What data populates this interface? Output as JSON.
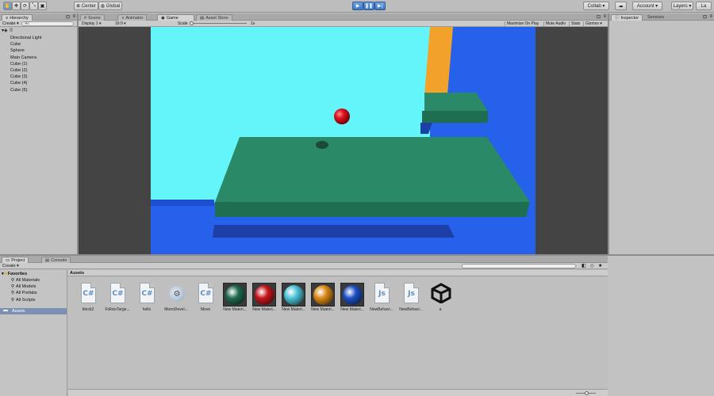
{
  "toolbar": {
    "pivot": "Center",
    "space": "Global",
    "collab": "Collab",
    "account": "Account",
    "layers": "Layers",
    "layout": "La"
  },
  "hierarchy": {
    "tab": "Hierarchy",
    "create": "Create",
    "search_placeholder": "All",
    "scene_icon": "unity-scene-icon",
    "items": [
      "Directional Light",
      "Cube",
      "Sphere",
      "Main Camera",
      "Cube (1)",
      "Cube (2)",
      "Cube (3)",
      "Cube (4)",
      "Cube (5)"
    ]
  },
  "center_tabs": [
    "Scene",
    "Animator",
    "Game",
    "Asset Store"
  ],
  "game_toolbar": {
    "display": "Display 1",
    "aspect": "16:9",
    "scale_label": "Scale",
    "scale_value": "1x",
    "maximize": "Maximize On Play",
    "mute": "Mute Audio",
    "stats": "Stats",
    "gizmos": "Gizmos"
  },
  "right_tabs": [
    "Inspector",
    "Services"
  ],
  "project": {
    "tabs": [
      "Project",
      "Console"
    ],
    "create": "Create",
    "favorites_label": "Favorites",
    "favorites": [
      "All Materials",
      "All Models",
      "All Prefabs",
      "All Scripts"
    ],
    "assets_folder": "Assets",
    "assets_header": "Assets",
    "assets": [
      {
        "name": "block2",
        "kind": "cs"
      },
      {
        "name": "FollowTarge...",
        "kind": "cs"
      },
      {
        "name": "hello",
        "kind": "cs"
      },
      {
        "name": "MonoDevel...",
        "kind": "mono"
      },
      {
        "name": "Move",
        "kind": "cs"
      },
      {
        "name": "New Materi...",
        "kind": "mat",
        "color": "#1f6b4f"
      },
      {
        "name": "New Materi...",
        "kind": "mat",
        "color": "#c4151c"
      },
      {
        "name": "New Materi...",
        "kind": "mat",
        "color": "#4cc3d6"
      },
      {
        "name": "New Materi...",
        "kind": "mat",
        "color": "#d98916"
      },
      {
        "name": "New Materi...",
        "kind": "mat",
        "color": "#1c4fc2"
      },
      {
        "name": "NewBehavi...",
        "kind": "js"
      },
      {
        "name": "NewBehavi...",
        "kind": "js"
      },
      {
        "name": "a",
        "kind": "unity"
      }
    ]
  },
  "colors": {
    "sky": "#64f5fb",
    "floor_blue": "#2561ea",
    "platform_top": "#2a8a67",
    "platform_side": "#1f6e52",
    "shadow": "#1c3fa8",
    "orange": "#f2a22a",
    "ball": "#d0101a"
  }
}
